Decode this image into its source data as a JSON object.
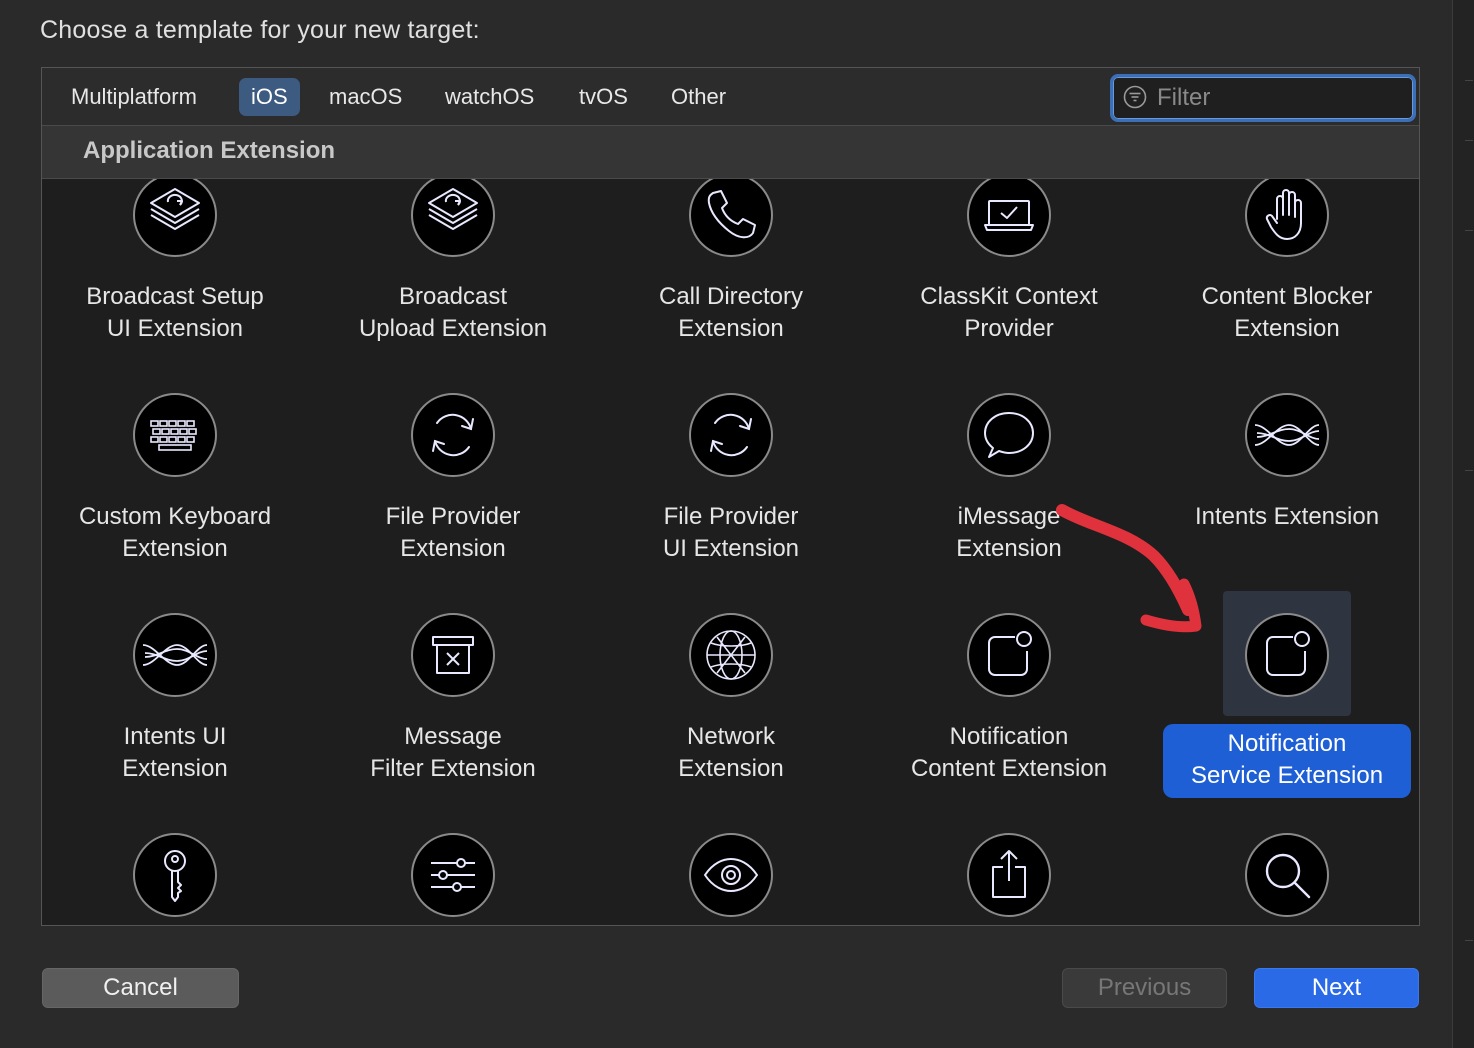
{
  "prompt": "Choose a template for your new target:",
  "tabs": [
    {
      "label": "Multiplatform",
      "active": false
    },
    {
      "label": "iOS",
      "active": true
    },
    {
      "label": "macOS",
      "active": false
    },
    {
      "label": "watchOS",
      "active": false
    },
    {
      "label": "tvOS",
      "active": false
    },
    {
      "label": "Other",
      "active": false
    }
  ],
  "filter": {
    "placeholder": "Filter",
    "value": ""
  },
  "section": "Application Extension",
  "templates": [
    {
      "label": "Broadcast Setup\nUI Extension",
      "icon": "broadcast-stack-icon"
    },
    {
      "label": "Broadcast\nUpload Extension",
      "icon": "broadcast-stack-icon"
    },
    {
      "label": "Call Directory\nExtension",
      "icon": "phone-icon"
    },
    {
      "label": "ClassKit Context\nProvider",
      "icon": "classkit-icon"
    },
    {
      "label": "Content Blocker\nExtension",
      "icon": "hand-icon"
    },
    {
      "label": "Custom Keyboard\nExtension",
      "icon": "keyboard-icon"
    },
    {
      "label": "File Provider\nExtension",
      "icon": "sync-arrows-icon"
    },
    {
      "label": "File Provider\nUI Extension",
      "icon": "sync-arrows-icon"
    },
    {
      "label": "iMessage\nExtension",
      "icon": "speech-bubble-icon"
    },
    {
      "label": "Intents Extension",
      "icon": "waves-icon"
    },
    {
      "label": "Intents UI\nExtension",
      "icon": "waves-icon"
    },
    {
      "label": "Message\nFilter Extension",
      "icon": "trash-box-icon"
    },
    {
      "label": "Network\nExtension",
      "icon": "globe-icon"
    },
    {
      "label": "Notification\nContent Extension",
      "icon": "notification-icon"
    },
    {
      "label": "Notification\nService Extension",
      "icon": "notification-icon",
      "selected": true
    },
    {
      "label": "",
      "icon": "key-icon"
    },
    {
      "label": "",
      "icon": "sliders-icon"
    },
    {
      "label": "",
      "icon": "eye-icon"
    },
    {
      "label": "",
      "icon": "share-icon"
    },
    {
      "label": "",
      "icon": "magnifier-icon"
    }
  ],
  "buttons": {
    "cancel": "Cancel",
    "previous": "Previous",
    "next": "Next"
  },
  "colors": {
    "selection": "#1f5fd6",
    "annotation_arrow": "#e0323c"
  }
}
